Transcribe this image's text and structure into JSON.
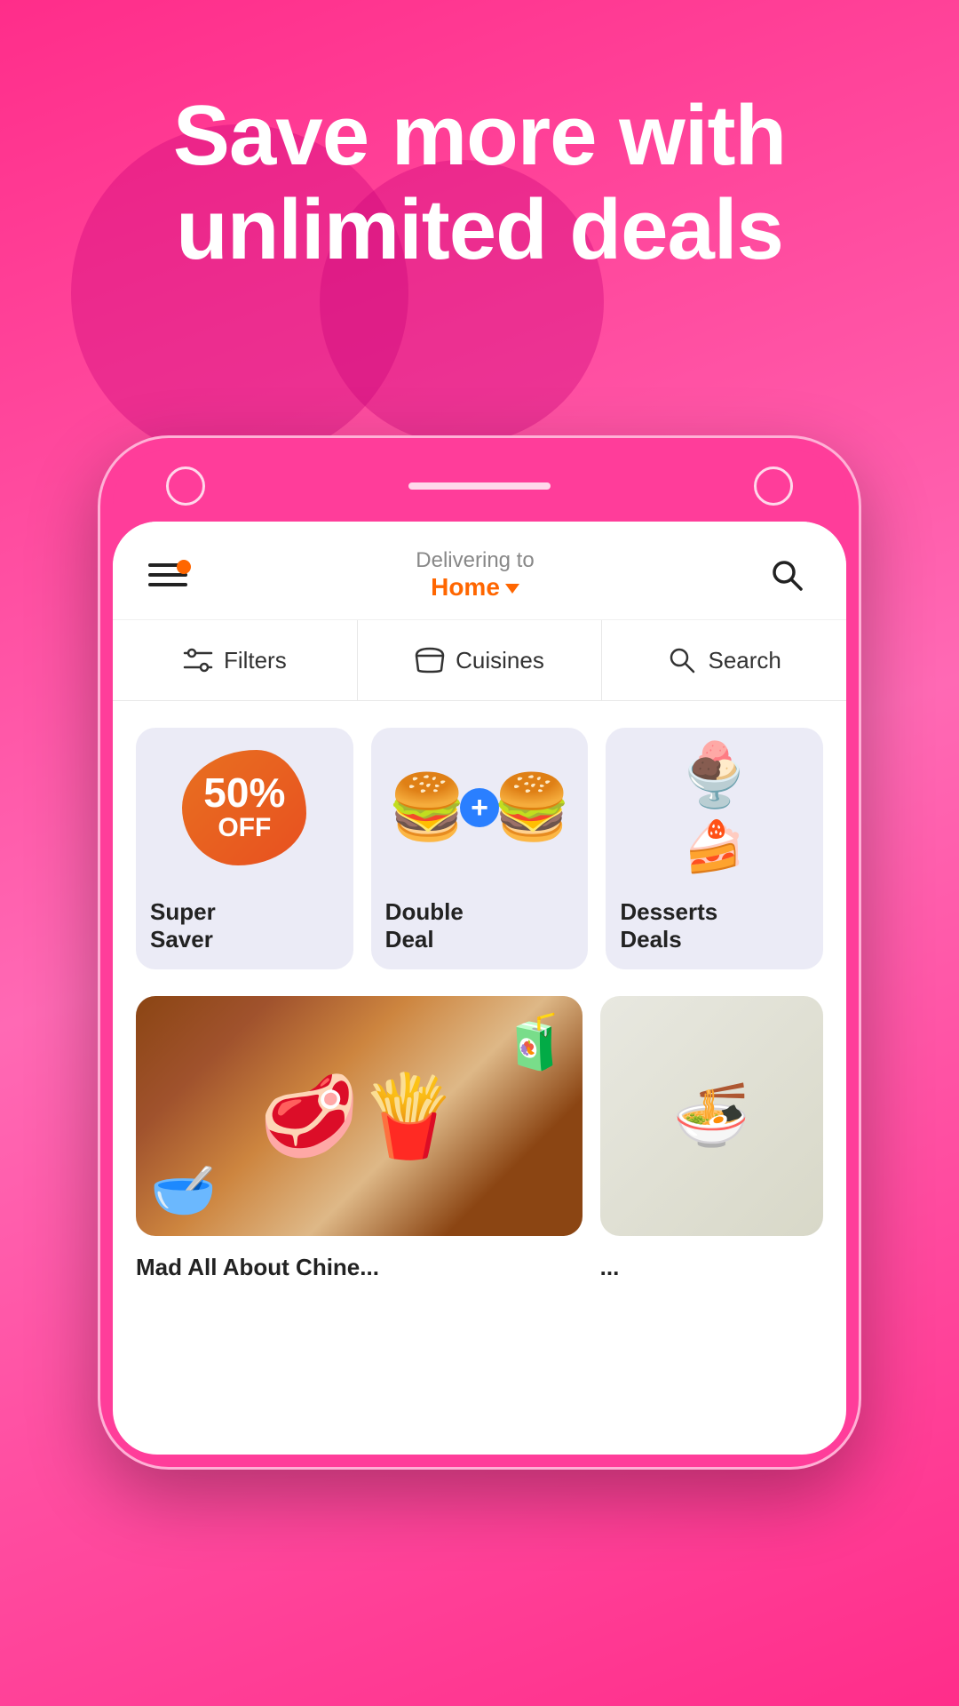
{
  "hero": {
    "title": "Save more with unlimited deals"
  },
  "phone": {
    "top_bar": {
      "circle_left": "",
      "notch": "",
      "circle_right": ""
    }
  },
  "header": {
    "delivering_label": "Delivering to",
    "location": "Home",
    "chevron": "▾"
  },
  "filter_bar": {
    "items": [
      {
        "id": "filters",
        "icon": "⊟",
        "label": "Filters"
      },
      {
        "id": "cuisines",
        "icon": "🍜",
        "label": "Cuisines"
      },
      {
        "id": "search",
        "icon": "🔍",
        "label": "Search"
      }
    ]
  },
  "deal_cards": [
    {
      "id": "super-saver",
      "badge_percent": "50%",
      "badge_off": "OFF",
      "title": "Super\nSaver"
    },
    {
      "id": "double-deal",
      "title": "Double\nDeal"
    },
    {
      "id": "desserts",
      "title": "Desserts\nDeals"
    }
  ],
  "food_items": [
    {
      "id": "chinese",
      "label": "Mad All About Chine...",
      "size": "large"
    },
    {
      "id": "asian",
      "label": "...",
      "size": "small"
    }
  ],
  "colors": {
    "primary_pink": "#ff2d8a",
    "accent_orange": "#ff6600",
    "accent_blue": "#2a7fff",
    "card_bg": "#ebebf6"
  }
}
